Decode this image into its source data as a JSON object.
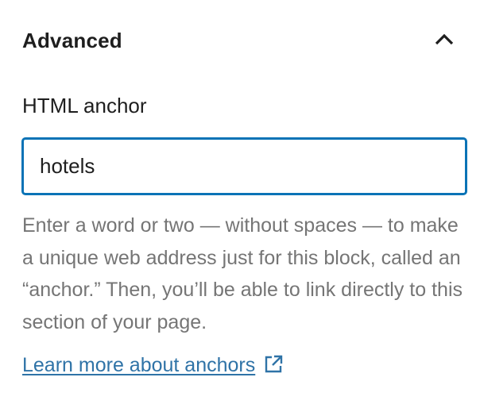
{
  "panel": {
    "title": "Advanced",
    "toggle_icon": "chevron-up-icon"
  },
  "anchor_field": {
    "label": "HTML anchor",
    "value": "hotels",
    "focus_color": "#0a73b6"
  },
  "help": {
    "text": "Enter a word or two — without spaces — to make a unique web address just for this block, called an “anchor.” Then, you’ll be able to link directly to this section of your page."
  },
  "learn_more": {
    "label": "Learn more about anchors",
    "icon": "external-link-icon",
    "color": "#2f73a7"
  }
}
